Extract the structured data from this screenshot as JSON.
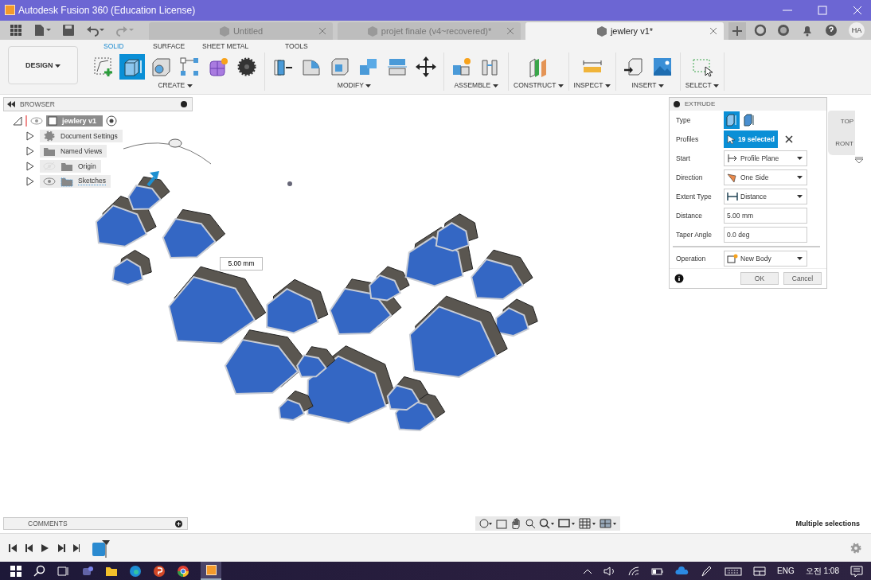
{
  "window": {
    "title": "Autodesk Fusion 360 (Education License)"
  },
  "tabs": [
    {
      "label": "Untitled",
      "selected": false
    },
    {
      "label": "projet finale (v4~recovered)*",
      "selected": false
    },
    {
      "label": "jewlery v1*",
      "selected": true
    }
  ],
  "user": {
    "initials": "HA"
  },
  "workspace": {
    "label": "DESIGN"
  },
  "ribbon_tabs": [
    {
      "label": "SOLID",
      "selected": true
    },
    {
      "label": "SURFACE",
      "selected": false
    },
    {
      "label": "SHEET METAL",
      "selected": false
    },
    {
      "label": "TOOLS",
      "selected": false
    }
  ],
  "ribbon_groups": [
    {
      "label": "CREATE",
      "tools": [
        {
          "kind": "sketch",
          "selected": false
        },
        {
          "kind": "extrude",
          "selected": true
        },
        {
          "kind": "hole",
          "selected": false
        },
        {
          "kind": "pattern",
          "selected": false
        },
        {
          "kind": "form",
          "selected": false
        },
        {
          "kind": "gear",
          "selected": false
        }
      ]
    },
    {
      "label": "MODIFY",
      "tools": [
        {
          "kind": "presspull",
          "selected": false
        },
        {
          "kind": "fillet",
          "selected": false
        },
        {
          "kind": "shell",
          "selected": false
        },
        {
          "kind": "combine",
          "selected": false
        },
        {
          "kind": "split",
          "selected": false
        },
        {
          "kind": "move",
          "selected": false
        }
      ]
    },
    {
      "label": "ASSEMBLE",
      "tools": [
        {
          "kind": "newcomponent",
          "selected": false
        },
        {
          "kind": "joint",
          "selected": false
        }
      ]
    },
    {
      "label": "CONSTRUCT",
      "tools": [
        {
          "kind": "plane",
          "selected": false
        }
      ]
    },
    {
      "label": "INSPECT",
      "tools": [
        {
          "kind": "measure",
          "selected": false
        }
      ]
    },
    {
      "label": "INSERT",
      "tools": [
        {
          "kind": "insert",
          "selected": false
        },
        {
          "kind": "canvas",
          "selected": false
        }
      ]
    },
    {
      "label": "SELECT",
      "tools": [
        {
          "kind": "select",
          "selected": false
        }
      ]
    }
  ],
  "browser": {
    "title": "BROWSER",
    "root": {
      "label": "jewlery v1",
      "expanded": true,
      "selected": true,
      "children": [
        {
          "label": "Document Settings",
          "kind": "settings",
          "expanded": false,
          "selected": false
        },
        {
          "label": "Named Views",
          "kind": "folder",
          "expanded": false,
          "selected": false
        },
        {
          "label": "Origin",
          "kind": "folder",
          "visible": false,
          "expanded": false,
          "selected": false
        },
        {
          "label": "Sketches",
          "kind": "sketches",
          "visible": true,
          "expanded": false,
          "selected": false
        }
      ]
    }
  },
  "viewport": {
    "dimension": "5.00 mm",
    "viewcube": [
      "TOP",
      "RONT"
    ]
  },
  "extrude": {
    "title": "EXTRUDE",
    "rows": [
      {
        "label": "Type",
        "kind": "type",
        "options": [
          {
            "selected": true
          },
          {
            "selected": false
          }
        ]
      },
      {
        "label": "Profiles",
        "kind": "selection",
        "value": "19 selected"
      },
      {
        "label": "Start",
        "kind": "dropdown",
        "value": "Profile Plane"
      },
      {
        "label": "Direction",
        "kind": "dropdown",
        "value": "One Side"
      },
      {
        "label": "Extent Type",
        "kind": "dropdown",
        "value": "Distance"
      },
      {
        "label": "Distance",
        "kind": "input",
        "value": "5.00 mm"
      },
      {
        "label": "Taper Angle",
        "kind": "input",
        "value": "0.0 deg"
      },
      {
        "label": "Operation",
        "kind": "dropdown",
        "value": "New Body",
        "divider": true
      }
    ],
    "buttons": [
      "OK",
      "Cancel"
    ]
  },
  "comments": {
    "title": "COMMENTS"
  },
  "status": "Multiple selections",
  "taskbar": {
    "language": "ENG",
    "time": "오전 1:08"
  }
}
